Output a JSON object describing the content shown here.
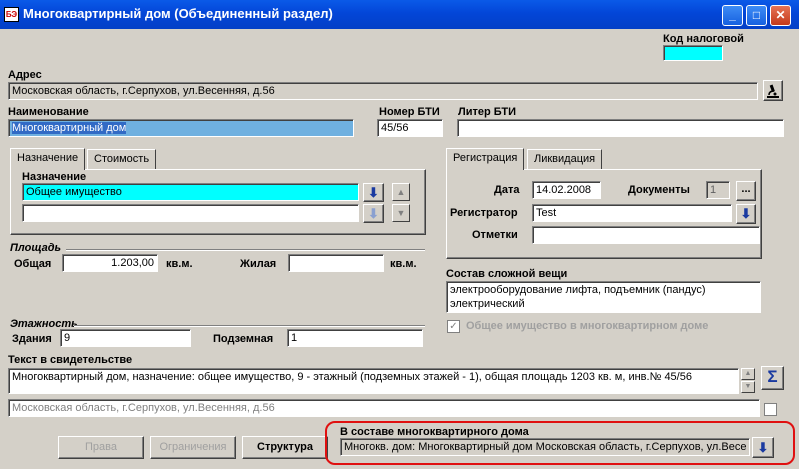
{
  "window": {
    "title": "Многоквартирный дом (Объединенный раздел)",
    "minimize": "_",
    "maximize": "□",
    "close": "✕",
    "app_icon_text": "БЭ"
  },
  "tax_code": {
    "label": "Код налоговой",
    "value": ""
  },
  "address": {
    "label": "Адрес",
    "value": "Московская область, г.Серпухов, ул.Весенняя, д.56"
  },
  "name": {
    "label": "Наименование",
    "value": "Многоквартирный дом"
  },
  "bti_number": {
    "label": "Номер БТИ",
    "value": "45/56"
  },
  "bti_letter": {
    "label": "Литер БТИ",
    "value": ""
  },
  "left_tabs": [
    {
      "label": "Назначение"
    },
    {
      "label": "Стоимость"
    }
  ],
  "purpose": {
    "label": "Назначение",
    "value1": "Общее имущество",
    "value2": "",
    "arrow": "⬇"
  },
  "area": {
    "title": "Площадь",
    "total_label": "Общая",
    "total_value": "1.203,00",
    "unit1": "кв.м.",
    "living_label": "Жилая",
    "living_value": "",
    "unit2": "кв.м."
  },
  "floors": {
    "title": "Этажность",
    "buildings_label": "Здания",
    "buildings_value": "9",
    "underground_label": "Подземная",
    "underground_value": "1"
  },
  "right_tabs": [
    {
      "label": "Регистрация"
    },
    {
      "label": "Ликвидация"
    }
  ],
  "registration": {
    "date_label": "Дата",
    "date_value": "14.02.2008",
    "documents_label": "Документы",
    "documents_value": "1",
    "documents_btn": "...",
    "registrar_label": "Регистратор",
    "registrar_value": "Test",
    "notes_label": "Отметки",
    "notes_value": ""
  },
  "composite": {
    "label": "Состав сложной вещи",
    "line1": "электрооборудование лифта,  подъемник (пандус)",
    "line2": "электрический"
  },
  "common_property": {
    "label": "Общее имущество в многоквартирном доме",
    "checked": true
  },
  "certificate": {
    "label": "Текст в свидетельстве",
    "value": "Многоквартирный дом, назначение: общее имущество, 9 - этажный (подземных этажей - 1), общая площадь 1203 кв. м, инв.№ 45/56",
    "address": "Московская область, г.Серпухов, ул.Весенняя, д.56",
    "sigma": "Σ"
  },
  "buttons": {
    "rights": "Права",
    "restrictions": "Ограничения",
    "structure": "Структура"
  },
  "in_building": {
    "label": "В составе многоквартирного дома",
    "value": "Многокв. дом: Многоквартирный дом Московская область, г.Серпухов, ул.Весе"
  }
}
